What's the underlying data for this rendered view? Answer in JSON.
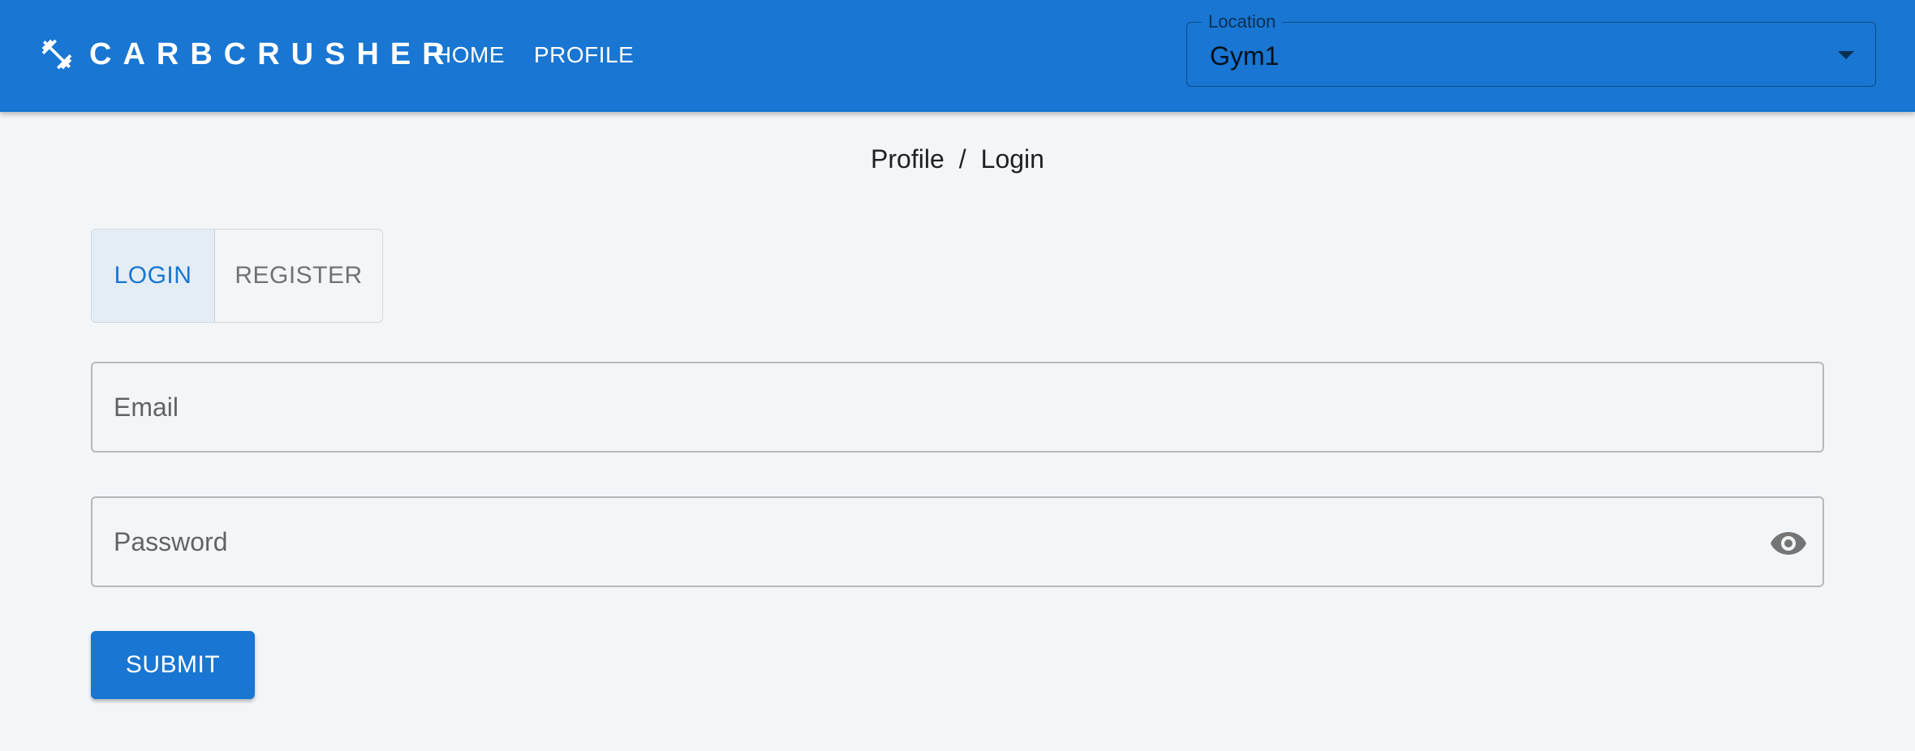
{
  "app": {
    "brand_name": "CARBCRUSHER",
    "logo_icon": "dumbbell-icon",
    "nav": [
      {
        "label": "HOME"
      },
      {
        "label": "PROFILE"
      }
    ],
    "location": {
      "label": "Location",
      "selected": "Gym1",
      "icon": "chevron-down-icon"
    }
  },
  "breadcrumb": {
    "items": [
      "Profile",
      "Login"
    ],
    "separator": "/"
  },
  "auth_toggle": {
    "login_label": "LOGIN",
    "register_label": "REGISTER",
    "active": "LOGIN"
  },
  "form": {
    "email_placeholder": "Email",
    "password_placeholder": "Password",
    "password_visibility_icon": "eye-icon",
    "submit_label": "SUBMIT"
  },
  "colors": {
    "primary": "#1976d2",
    "background": "#f3f6f9"
  }
}
